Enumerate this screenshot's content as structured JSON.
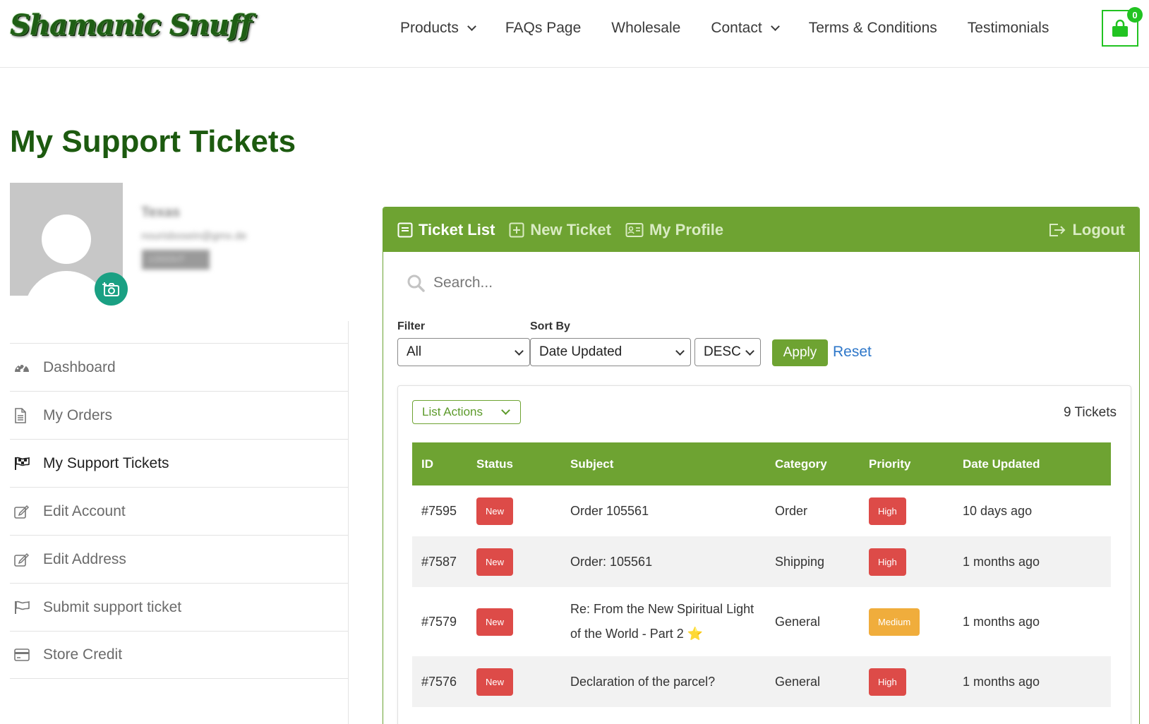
{
  "header": {
    "logo_text": "Shamanic Snuff",
    "nav": [
      {
        "label": "Products",
        "has_dropdown": true
      },
      {
        "label": "FAQs Page",
        "has_dropdown": false
      },
      {
        "label": "Wholesale",
        "has_dropdown": false
      },
      {
        "label": "Contact",
        "has_dropdown": true
      },
      {
        "label": "Terms & Conditions",
        "has_dropdown": false
      },
      {
        "label": "Testimonials",
        "has_dropdown": false
      }
    ],
    "cart_count": "0",
    "cart_icon": "shopping-bag-icon"
  },
  "page_title": "My Support Tickets",
  "profile": {
    "avatar_icon": "user-placeholder-icon",
    "upload_icon": "camera-add-icon",
    "name_blurred": "Texas",
    "email_blurred": "nourisbosein@gmx.de",
    "logout_blurred": "LOGOUT"
  },
  "sidebar": {
    "items": [
      {
        "label": "Dashboard",
        "icon": "dashboard-gauge-icon",
        "active": false
      },
      {
        "label": "My Orders",
        "icon": "document-icon",
        "active": false
      },
      {
        "label": "My Support Tickets",
        "icon": "checkered-flag-icon",
        "active": true
      },
      {
        "label": "Edit Account",
        "icon": "edit-icon",
        "active": false
      },
      {
        "label": "Edit Address",
        "icon": "edit-icon",
        "active": false
      },
      {
        "label": "Submit support ticket",
        "icon": "flag-icon",
        "active": false
      },
      {
        "label": "Store Credit",
        "icon": "credit-card-icon",
        "active": false
      }
    ]
  },
  "support": {
    "tabs": {
      "ticket_list": "Ticket List",
      "new_ticket": "New Ticket",
      "my_profile": "My Profile",
      "logout": "Logout"
    },
    "search_placeholder": "Search...",
    "filter_label": "Filter",
    "filter_value": "All",
    "sort_label": "Sort By",
    "sort_value": "Date Updated",
    "order_value": "DESC",
    "apply": "Apply",
    "reset": "Reset",
    "list_actions": "List Actions",
    "ticket_count": "9 Tickets",
    "columns": [
      "ID",
      "Status",
      "Subject",
      "Category",
      "Priority",
      "Date Updated"
    ],
    "tickets": [
      {
        "id": "#7595",
        "status": "New",
        "subject": "Order 105561",
        "subject_line2": "",
        "category": "Order",
        "priority": "High",
        "updated": "10 days ago"
      },
      {
        "id": "#7587",
        "status": "New",
        "subject": "Order: 105561",
        "subject_line2": "",
        "category": "Shipping",
        "priority": "High",
        "updated": "1 months ago"
      },
      {
        "id": "#7579",
        "status": "New",
        "subject": "Re: From the New Spiritual Light",
        "subject_line2": "of the World - Part 2 ⭐",
        "category": "General",
        "priority": "Medium",
        "updated": "1 months ago"
      },
      {
        "id": "#7576",
        "status": "New",
        "subject": "Declaration of the parcel?",
        "subject_line2": "",
        "category": "General",
        "priority": "High",
        "updated": "1 months ago"
      }
    ]
  },
  "colors": {
    "brand_green": "#6ea332",
    "title_green": "#1c5a0f",
    "status_new": "#dd4b48",
    "priority_high": "#dd4b48",
    "priority_medium": "#f0ad3c",
    "cart_green": "#21c321",
    "link_blue": "#2e77c9"
  }
}
